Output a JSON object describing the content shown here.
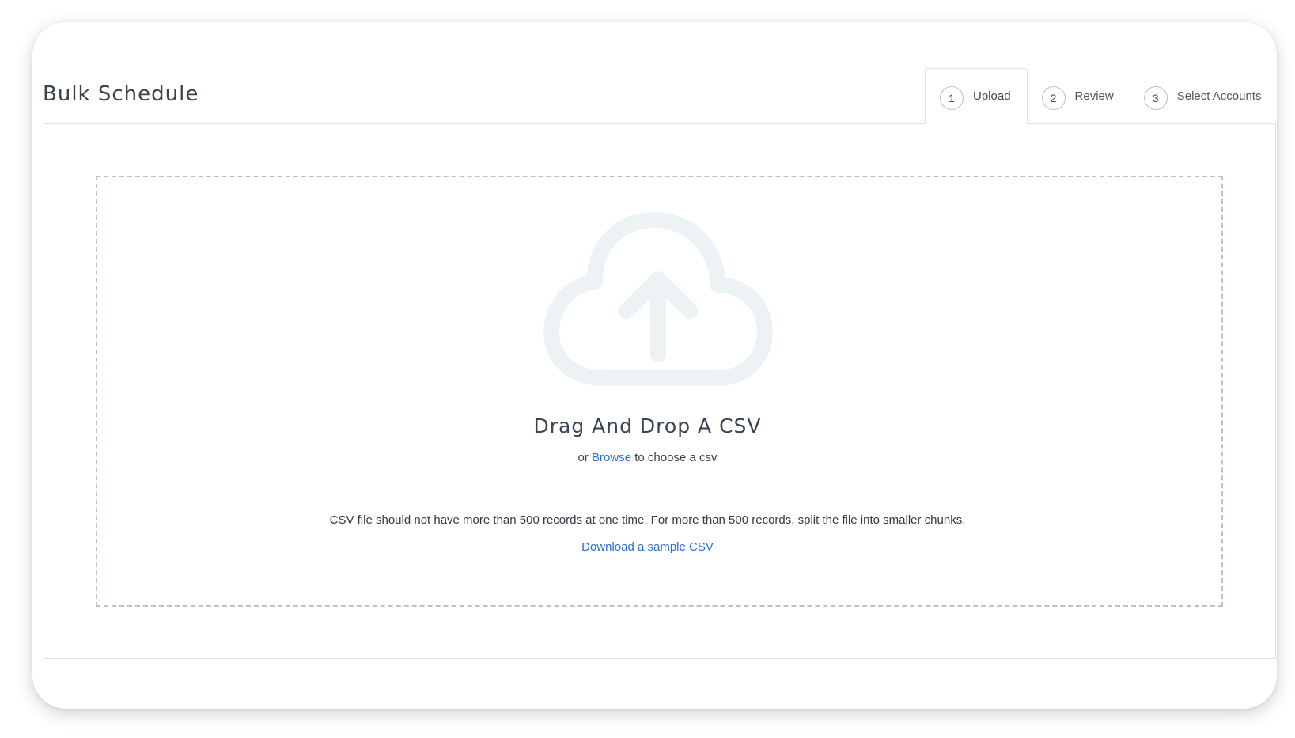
{
  "header": {
    "title": "Bulk Schedule"
  },
  "stepper": {
    "steps": [
      {
        "number": "1",
        "label": "Upload",
        "active": true
      },
      {
        "number": "2",
        "label": "Review",
        "active": false
      },
      {
        "number": "3",
        "label": "Select Accounts",
        "active": false
      }
    ]
  },
  "dropzone": {
    "icon": "cloud-upload-icon",
    "title": "Drag And Drop A CSV",
    "browse_prefix": "or",
    "browse_link": "Browse",
    "browse_suffix": "to choose a csv",
    "limit_note": "CSV file should not have more than 500 records at one time. For more than 500 records, split the file into smaller chunks.",
    "sample_link": "Download a sample CSV"
  },
  "colors": {
    "link": "#2a6fd6",
    "icon": "#edf3f5",
    "dash_border": "#b9c2cc"
  }
}
